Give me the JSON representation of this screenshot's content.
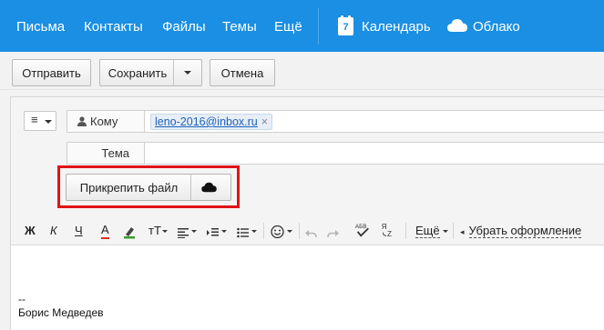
{
  "nav": {
    "items": [
      "Письма",
      "Контакты",
      "Файлы",
      "Темы",
      "Ещё"
    ],
    "calendar_label": "Календарь",
    "calendar_day": "7",
    "cloud_label": "Облако"
  },
  "toolbar": {
    "send_label": "Отправить",
    "save_label": "Сохранить",
    "cancel_label": "Отмена"
  },
  "compose": {
    "menu_glyph": "≡",
    "to_label": "Кому",
    "recipient": "leno-2016@inbox.ru",
    "remove_glyph": "×",
    "subject_label": "Тема",
    "subject_value": "",
    "attach_label": "Прикрепить файл"
  },
  "format_bar": {
    "bold": "Ж",
    "italic": "К",
    "underline": "Ч",
    "text_color": "А",
    "font_size": "тТ",
    "more_label": "Ещё",
    "clear_format_label": "Убрать оформление"
  },
  "body": {
    "signature_dash": "--",
    "signature_name": "Борис Медведев"
  },
  "colors": {
    "nav_bg": "#1a8fe3",
    "highlight": "#e11313",
    "link": "#1f62b8"
  }
}
